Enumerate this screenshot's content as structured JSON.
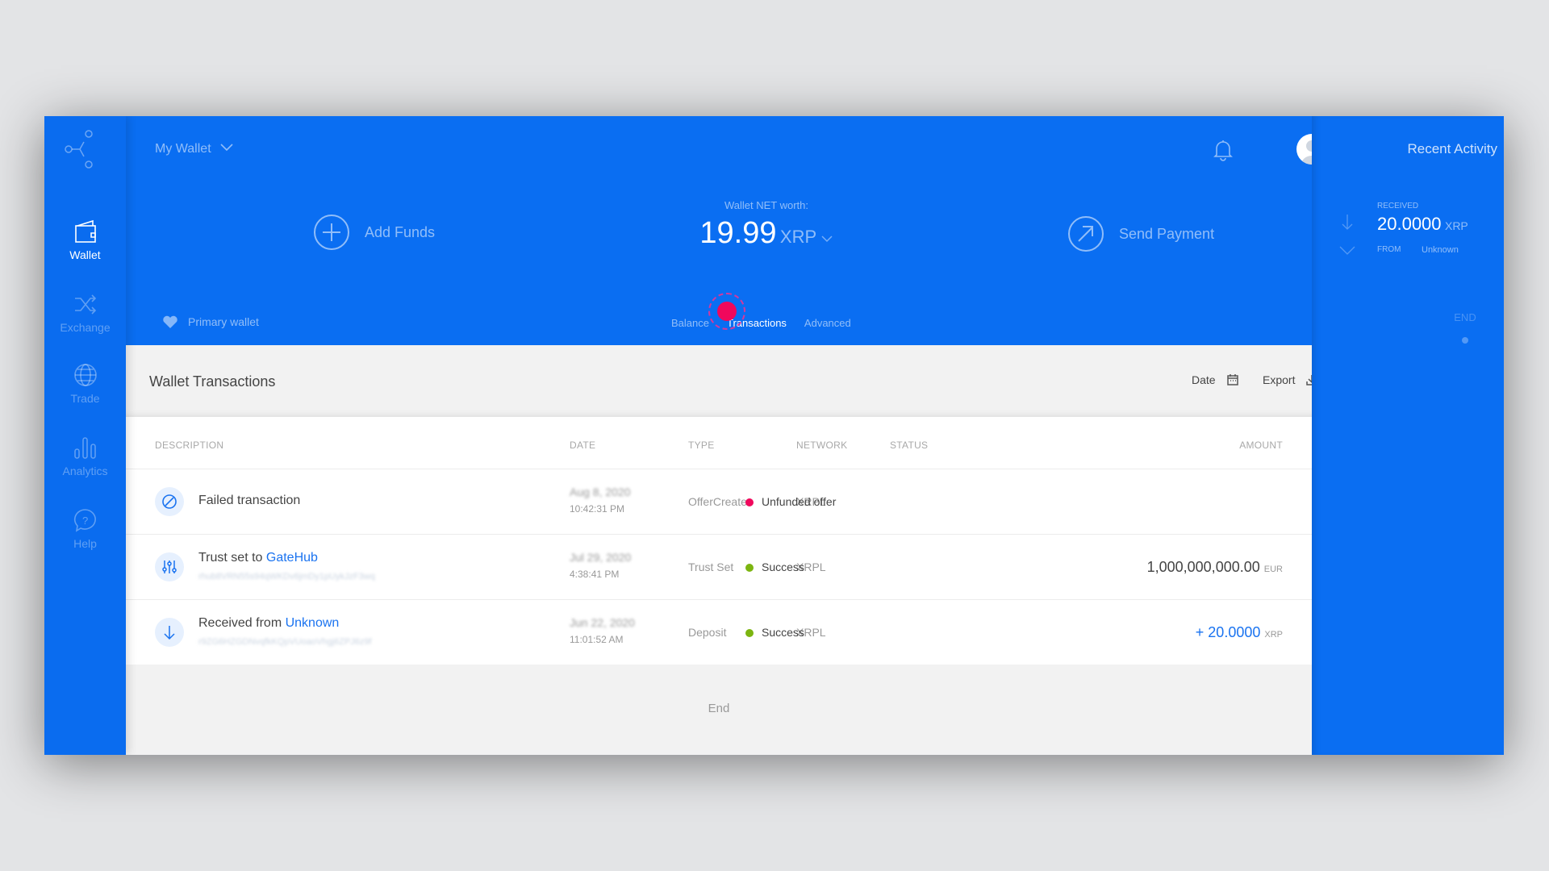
{
  "sidebar": {
    "items": [
      {
        "label": "Wallet",
        "icon": "wallet-icon",
        "active": true
      },
      {
        "label": "Exchange",
        "icon": "shuffle-icon"
      },
      {
        "label": "Trade",
        "icon": "globe-icon"
      },
      {
        "label": "Analytics",
        "icon": "bar-chart-icon"
      },
      {
        "label": "Help",
        "icon": "help-bubble-icon"
      }
    ]
  },
  "header": {
    "wallet_name": "My Wallet",
    "add_funds": "Add Funds",
    "net_worth_label": "Wallet NET worth:",
    "net_worth_value": "19.99",
    "net_worth_currency": "XRP",
    "send_payment": "Send Payment",
    "primary_wallet": "Primary wallet",
    "tabs": [
      "Balance",
      "Transactions",
      "Advanced"
    ],
    "active_tab": "Transactions"
  },
  "panel": {
    "title": "Wallet Transactions",
    "date_button": "Date",
    "export_button": "Export"
  },
  "table": {
    "columns": [
      "DESCRIPTION",
      "DATE",
      "TYPE",
      "NETWORK",
      "STATUS",
      "AMOUNT"
    ],
    "rows": [
      {
        "icon": "blocked-icon",
        "desc": "Failed transaction",
        "link": "",
        "hash": "",
        "date": "Aug 8, 2020",
        "time": "10:42:31 PM",
        "type": "OfferCreate",
        "network": "XRPL",
        "status": "Unfunded offer",
        "status_color": "#f0085c",
        "amount": "",
        "currency": ""
      },
      {
        "icon": "sliders-icon",
        "desc": "Trust set to ",
        "link": "GateHub",
        "hash": "rhub8VRN55s94qWKDv6jmDy1pUykJzF3wq",
        "date": "Jul 29, 2020",
        "time": "4:38:41 PM",
        "type": "Trust Set",
        "network": "XRPL",
        "status": "Success",
        "status_color": "#7cb510",
        "amount": "1,000,000,000.00",
        "currency": "EUR"
      },
      {
        "icon": "arrow-down-icon",
        "desc": "Received from ",
        "link": "Unknown",
        "hash": "r9ZG6HZGDNvqfkKQpVUoaoVhgj6ZPJ6z9f",
        "date": "Jun 22, 2020",
        "time": "11:01:52 AM",
        "type": "Deposit",
        "network": "XRPL",
        "status": "Success",
        "status_color": "#7cb510",
        "amount": "+ 20.0000",
        "currency": "XRP"
      }
    ],
    "end_label": "End"
  },
  "recent": {
    "title": "Recent Activity",
    "kind": "RECEIVED",
    "amount": "20.0000",
    "currency": "XRP",
    "from_label": "FROM",
    "from_value": "Unknown",
    "end_label": "END"
  },
  "colors": {
    "brand": "#0a6ef2",
    "error": "#f0085c",
    "success": "#7cb510",
    "link": "#1a73f0"
  }
}
